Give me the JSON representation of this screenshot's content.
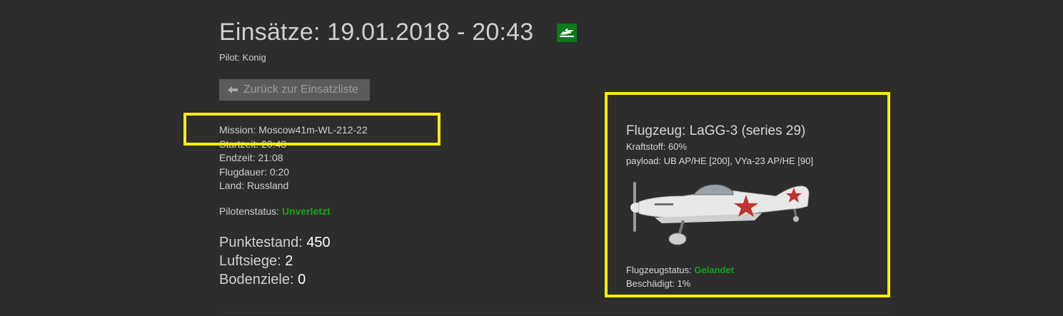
{
  "header": {
    "title": "Einsätze: 19.01.2018 - 20:43",
    "type_icon": "ground-attack-plane-icon",
    "pilot_label": "Pilot:",
    "pilot_name": "Konig"
  },
  "back_button": {
    "label": "Zurück zur Einsatzliste",
    "icon": "arrow-left-icon"
  },
  "mission": {
    "mission": {
      "label": "Mission:",
      "value": "Moscow41m-WL-212-22"
    },
    "startzeit": {
      "label": "Startzeit:",
      "value": "20:43"
    },
    "endzeit": {
      "label": "Endzeit:",
      "value": "21:08"
    },
    "flugdauer": {
      "label": "Flugdauer:",
      "value": "0:20"
    },
    "land": {
      "label": "Land:",
      "value": "Russland"
    }
  },
  "pilot_status": {
    "label": "Pilotenstatus:",
    "value": "Unverletzt"
  },
  "stats": {
    "punktestand": {
      "label": "Punktestand:",
      "value": "450"
    },
    "luftsiege": {
      "label": "Luftsiege:",
      "value": "2"
    },
    "bodenziele": {
      "label": "Bodenziele:",
      "value": "0"
    }
  },
  "aircraft": {
    "title_label": "Flugzeug:",
    "title_value": "LaGG-3 (series 29)",
    "kraftstoff": {
      "label": "Kraftstoff:",
      "value": "60%"
    },
    "payload": {
      "label": "payload:",
      "value": "UB AP/HE [200], VYa-23 AP/HE [90]"
    },
    "image_icon": "lagg3-aircraft-picture",
    "status": {
      "label": "Flugzeugstatus:",
      "value": "Gelandet"
    },
    "damage": {
      "label": "Beschädigt:",
      "value": "1%"
    }
  },
  "colors": {
    "background": "#2d2d2d",
    "highlight": "#ffee00",
    "status_green": "#16a21c",
    "badge_green": "#0c7a1c",
    "button_bg": "#5b5b5b"
  }
}
